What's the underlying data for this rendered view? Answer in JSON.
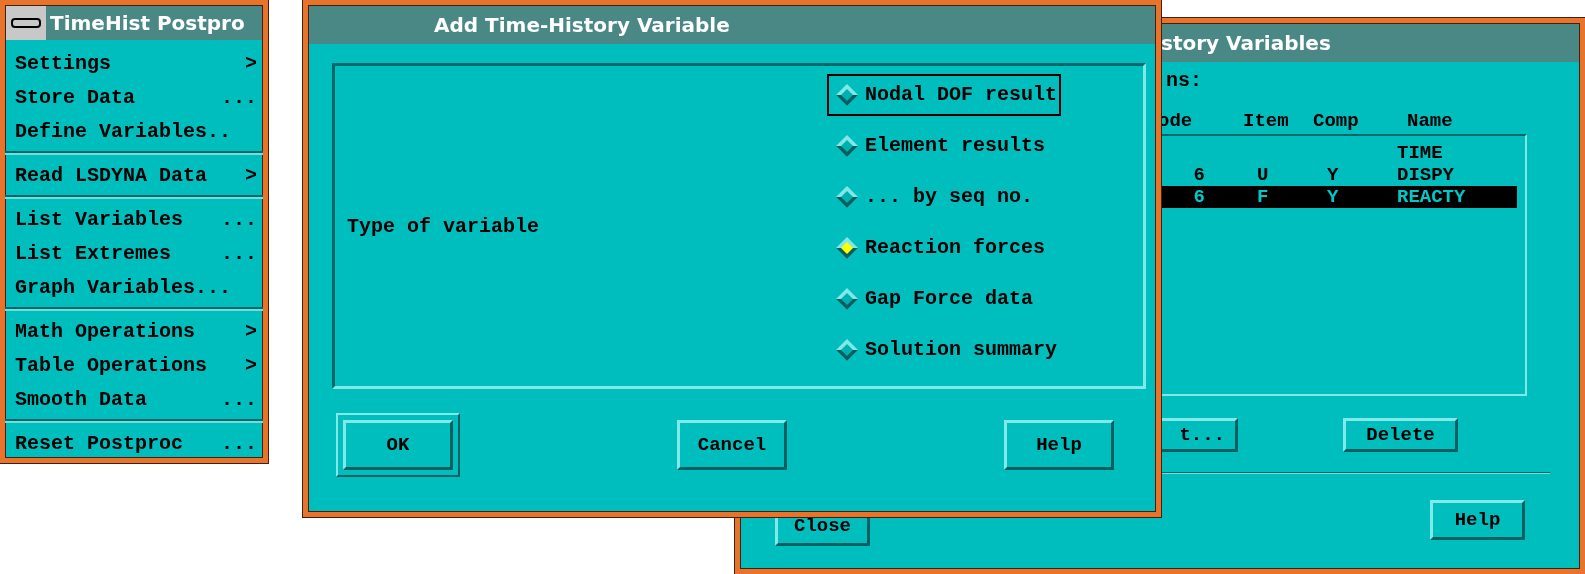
{
  "menu": {
    "title": "TimeHist Postpro",
    "groups": [
      {
        "items": [
          {
            "label": "Settings",
            "suffix": ">"
          },
          {
            "label": "Store Data",
            "suffix": "..."
          },
          {
            "label": "Define Variables.."
          }
        ]
      },
      {
        "items": [
          {
            "label": "Read LSDYNA Data",
            "suffix": ">"
          }
        ]
      },
      {
        "items": [
          {
            "label": "List Variables",
            "suffix": "..."
          },
          {
            "label": "List Extremes",
            "suffix": "..."
          },
          {
            "label": "Graph Variables..."
          }
        ]
      },
      {
        "items": [
          {
            "label": "Math Operations",
            "suffix": ">"
          },
          {
            "label": "Table Operations",
            "suffix": ">"
          },
          {
            "label": "Smooth Data",
            "suffix": "..."
          }
        ]
      },
      {
        "items": [
          {
            "label": "Reset Postproc",
            "suffix": "..."
          }
        ]
      }
    ]
  },
  "back_window": {
    "title": "story Variables",
    "caption": "ns:",
    "columns": [
      "ode",
      "Item",
      "Comp",
      "Name"
    ],
    "rows": [
      {
        "cells": [
          "",
          "",
          "",
          "TIME"
        ],
        "selected": false
      },
      {
        "cells": [
          "6",
          "U",
          "Y",
          "DISPY"
        ],
        "selected": false
      },
      {
        "cells": [
          "6",
          "F",
          "Y",
          "REACTY"
        ],
        "selected": true
      }
    ],
    "list_buttons": [
      "t...",
      "Delete"
    ],
    "footer_buttons": [
      "Close",
      "Help"
    ]
  },
  "dialog": {
    "title": "Add Time-History Variable",
    "field_label": "Type of variable",
    "options": [
      {
        "label": "Nodal DOF result",
        "selected": false,
        "focused": true
      },
      {
        "label": "Element results",
        "selected": false,
        "focused": false
      },
      {
        "label": "... by seq no.",
        "selected": false,
        "focused": false
      },
      {
        "label": "Reaction forces",
        "selected": true,
        "focused": false
      },
      {
        "label": "Gap Force data",
        "selected": false,
        "focused": false
      },
      {
        "label": "Solution summary",
        "selected": false,
        "focused": false
      }
    ],
    "buttons": [
      {
        "label": "OK",
        "default": true
      },
      {
        "label": "Cancel",
        "default": false
      },
      {
        "label": "Help",
        "default": false
      }
    ]
  }
}
